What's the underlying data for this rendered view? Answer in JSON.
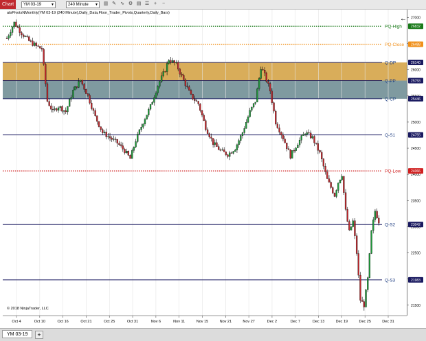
{
  "toolbar": {
    "chart_tab": "Chart",
    "instrument": "YM 03-19",
    "interval": "240 Minute",
    "icons": [
      "bar-style-icon",
      "draw-icon",
      "indicator-icon",
      "strategy-icon",
      "template-icon",
      "properties-icon",
      "zoom-in-icon",
      "zoom-out-icon"
    ]
  },
  "indicator_label": "atsPivotsNMonthly(YM 03-19 (240 Minute),Daily_Data,Floor_Trader_Pivots,Quarterly,Daily_Bars)",
  "copyright": "© 2018 NinjaTrader, LLC",
  "bottom_tab": "YM 03-19",
  "add_tab": "+",
  "chart_data": {
    "type": "candlestick",
    "ylim": [
      21300,
      27150
    ],
    "y_ticks": [
      27000,
      26500,
      26000,
      25500,
      25000,
      24500,
      24000,
      23500,
      23000,
      22500,
      22000,
      21500
    ],
    "x_ticks": [
      "Oct 4",
      "Oct 10",
      "Oct 16",
      "Oct 21",
      "Oct 25",
      "Oct 31",
      "Nov 6",
      "Nov 11",
      "Nov 15",
      "Nov 21",
      "Nov 27",
      "Dec 2",
      "Dec 7",
      "Dec 13",
      "Dec 19",
      "Dec 25",
      "Dec 31"
    ],
    "levels": [
      {
        "name": "PQ-High",
        "value": 26832,
        "label": "26832",
        "color": "#1a7a1a",
        "style": "dotted"
      },
      {
        "name": "PQ-Close",
        "value": 26488,
        "label": "26488",
        "color": "#f0901a",
        "style": "dotted"
      },
      {
        "name": "Q-DP",
        "value": 26140,
        "label": "26140",
        "color": "#1a1a60",
        "style": "solid"
      },
      {
        "name": "Q-PP",
        "value": 25793,
        "label": "25793",
        "color": "#1a1a60",
        "style": "solid"
      },
      {
        "name": "Q-CP",
        "value": 25446,
        "label": "25446",
        "color": "#1a1a60",
        "style": "solid"
      },
      {
        "name": "Q-S1",
        "value": 24755,
        "label": "24755",
        "color": "#1a1a60",
        "style": "solid"
      },
      {
        "name": "PQ-Low",
        "value": 24066,
        "label": "24066",
        "color": "#d02020",
        "style": "dotted"
      },
      {
        "name": "Q-S2",
        "value": 23042,
        "label": "23042",
        "color": "#1a1a60",
        "style": "solid"
      },
      {
        "name": "Q-S3",
        "value": 21983,
        "label": "21983",
        "color": "#1a1a60",
        "style": "solid"
      }
    ],
    "zones": [
      {
        "from": 26140,
        "to": 25793,
        "color": "#d9ad5a"
      },
      {
        "from": 25793,
        "to": 25446,
        "color": "#7f9aa0"
      }
    ],
    "price_path": [
      [
        0,
        26600
      ],
      [
        4,
        26900
      ],
      [
        8,
        26700
      ],
      [
        12,
        26550
      ],
      [
        16,
        26450
      ],
      [
        19,
        26400
      ],
      [
        22,
        25400
      ],
      [
        25,
        25200
      ],
      [
        28,
        25300
      ],
      [
        32,
        25200
      ],
      [
        36,
        25600
      ],
      [
        40,
        25800
      ],
      [
        44,
        25500
      ],
      [
        48,
        25100
      ],
      [
        52,
        24800
      ],
      [
        56,
        24700
      ],
      [
        60,
        24600
      ],
      [
        64,
        24450
      ],
      [
        67,
        24300
      ],
      [
        70,
        24650
      ],
      [
        74,
        25000
      ],
      [
        78,
        25300
      ],
      [
        82,
        25700
      ],
      [
        86,
        26000
      ],
      [
        88,
        26200
      ],
      [
        90,
        26150
      ],
      [
        92,
        26100
      ],
      [
        96,
        25800
      ],
      [
        100,
        25500
      ],
      [
        104,
        25350
      ],
      [
        108,
        24900
      ],
      [
        112,
        24600
      ],
      [
        116,
        24450
      ],
      [
        120,
        24380
      ],
      [
        124,
        24500
      ],
      [
        128,
        24800
      ],
      [
        132,
        25200
      ],
      [
        135,
        25400
      ],
      [
        138,
        26050
      ],
      [
        140,
        25900
      ],
      [
        143,
        25600
      ],
      [
        146,
        25000
      ],
      [
        150,
        24700
      ],
      [
        154,
        24350
      ],
      [
        158,
        24600
      ],
      [
        162,
        24800
      ],
      [
        166,
        24700
      ],
      [
        170,
        24400
      ],
      [
        174,
        23900
      ],
      [
        178,
        23600
      ],
      [
        180,
        23850
      ],
      [
        182,
        24000
      ],
      [
        184,
        23300
      ],
      [
        186,
        22900
      ],
      [
        188,
        23100
      ],
      [
        190,
        22500
      ],
      [
        192,
        21600
      ],
      [
        194,
        21500
      ],
      [
        196,
        22000
      ],
      [
        198,
        22900
      ],
      [
        200,
        23300
      ],
      [
        202,
        23100
      ]
    ]
  }
}
